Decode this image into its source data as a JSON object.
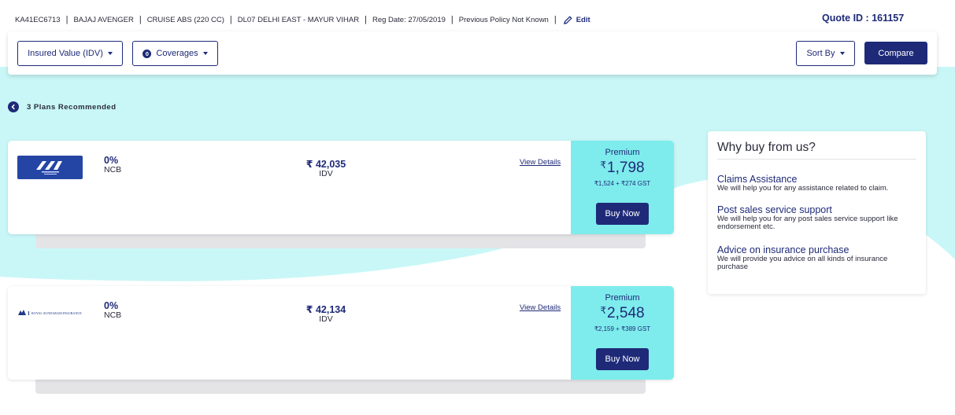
{
  "header": {
    "vehicle_info": [
      "KA41EC6713",
      "BAJAJ AVENGER",
      "CRUISE ABS (220 CC)",
      "DL07 DELHI EAST - MAYUR VIHAR",
      "Reg Date: 27/05/2019",
      "Previous Policy Not Known"
    ],
    "edit_label": "Edit",
    "quote_id": "Quote ID : 161157"
  },
  "filters": {
    "idv_label": "Insured Value (IDV)",
    "coverages_count": "0",
    "coverages_label": "Coverages",
    "sort_label": "Sort By",
    "compare_label": "Compare"
  },
  "plans_recommended": "3 Plans Recommended",
  "plans": [
    {
      "insurer_icon": "united-india-logo",
      "ncb": "0%",
      "ncb_label": "NCB",
      "idv": "₹ 42,035",
      "idv_label": "IDV",
      "view_details": "View Details",
      "premium_label": "Premium",
      "premium_symbol": "₹",
      "premium": "1,798",
      "premium_breakup": "₹1,524 + ₹274 GST",
      "buy_label": "Buy Now"
    },
    {
      "insurer_icon": "royal-sundaram-logo",
      "insurer_logo_text": "ROYAL SUNDARAM INSURANCE",
      "ncb": "0%",
      "ncb_label": "NCB",
      "idv": "₹ 42,134",
      "idv_label": "IDV",
      "view_details": "View Details",
      "premium_label": "Premium",
      "premium_symbol": "₹",
      "premium": "2,548",
      "premium_breakup": "₹2,159 + ₹389 GST",
      "buy_label": "Buy Now"
    }
  ],
  "why_buy": {
    "title": "Why buy from us?",
    "items": [
      {
        "heading": "Claims Assistance",
        "desc": "We will help you for any assistance related to claim."
      },
      {
        "heading": "Post sales service support",
        "desc": "We will help you for any post sales service support like endorsement etc."
      },
      {
        "heading": "Advice on insurance purchase",
        "desc": "We will provide you advice on all kinds of insurance purchase"
      }
    ]
  },
  "colors": {
    "primary": "#1e2a78",
    "accent_cyan": "#7eecec",
    "background_wave": "#c9f7f7"
  }
}
